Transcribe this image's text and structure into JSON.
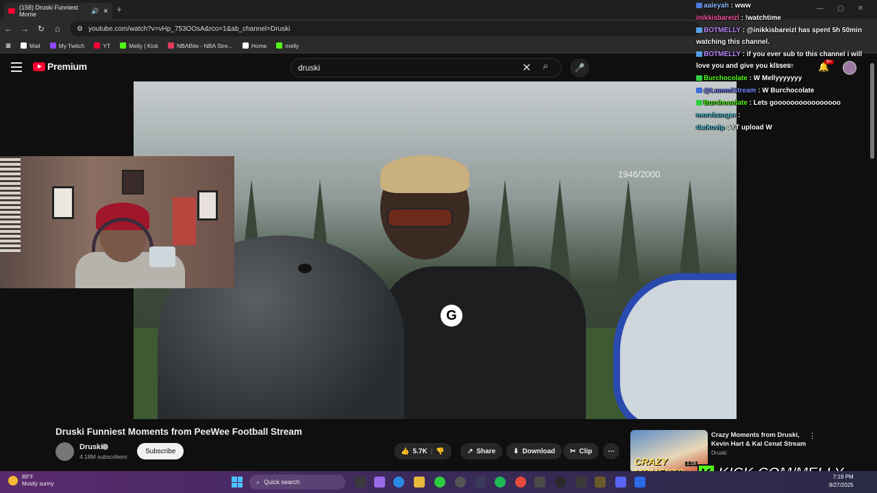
{
  "browser": {
    "tab_title": "(158) Druski Funniest Mome",
    "new_tab": "+",
    "url": "youtube.com/watch?v=vHp_753OOsA&rco=1&ab_channel=Druski",
    "bookmarks": [
      {
        "label": "Mail",
        "color": "#ffffff"
      },
      {
        "label": "My Twitch",
        "color": "#9146ff"
      },
      {
        "label": "YT",
        "color": "#ff0033"
      },
      {
        "label": "Melly | Kick",
        "color": "#53fc18"
      },
      {
        "label": "NBABite - NBA Stre...",
        "color": "#e23a5a"
      },
      {
        "label": "Home",
        "color": "#ffffff"
      },
      {
        "label": "melly",
        "color": "#53fc18"
      }
    ]
  },
  "youtube": {
    "logo_text": "Premium",
    "search_value": "druski",
    "create_label": "Create",
    "notification_count": "9+",
    "video_counter": "1946/2000",
    "video_title": "Druski Funniest Moments from PeeWee Football Stream",
    "channel_name": "Druski",
    "subscribers": "4.18M subscribers",
    "subscribe_label": "Subscribe",
    "like_count": "5.7K",
    "share_label": "Share",
    "download_label": "Download",
    "clip_label": "Clip",
    "recommended": {
      "title": "Crazy Moments from Druski, Kevin Hart & Kai Cenat Stream",
      "channel": "Druski",
      "thumb_text": "CRAZY MOMENTS",
      "duration": "1:19"
    }
  },
  "chat": [
    {
      "user": "aaleyah",
      "text": ": www",
      "color": "#8ab8ff",
      "badge": "#4a7ad8"
    },
    {
      "user": "inikkisbareizl",
      "text": ": !watchtime",
      "color": "#ff5aa0",
      "badge": ""
    },
    {
      "user": "BOTMELLY",
      "text": ": @inikkisbareizl has spent 5h 50min watching this channel.",
      "color": "#c08aff",
      "badge": "#53a0e8"
    },
    {
      "user": "BOTMELLY",
      "text": ": if you ever sub to this channel i will love you and give you kisses",
      "color": "#c08aff",
      "badge": "#53a0e8"
    },
    {
      "user": "Burchocolate",
      "text": ": W Mellyyyyyyy",
      "color": "#53fc18",
      "badge": "#2ecc40"
    },
    {
      "user": "@LummiStream",
      "text": ": W Burchocolate",
      "color": "#7a8aff",
      "badge": "#3a6ad8"
    },
    {
      "user": "Burchocolate",
      "text": ": Lets goooooooooooooooo",
      "color": "#53fc18",
      "badge": "#2ecc40"
    },
    {
      "user": "morebunger",
      "text": ":",
      "color": "#5ac8d8",
      "badge": ""
    },
    {
      "user": "darkovip",
      "text": ": YT upload W",
      "color": "#5ac8d8",
      "badge": ""
    }
  ],
  "kick_url": "KICK.COM/MELLY",
  "kick_letter": "K",
  "taskbar": {
    "temp": "89°F",
    "condition": "Mostly sunny",
    "search_label": "Quick search",
    "time": "7:19 PM",
    "date": "8/27/2025"
  }
}
